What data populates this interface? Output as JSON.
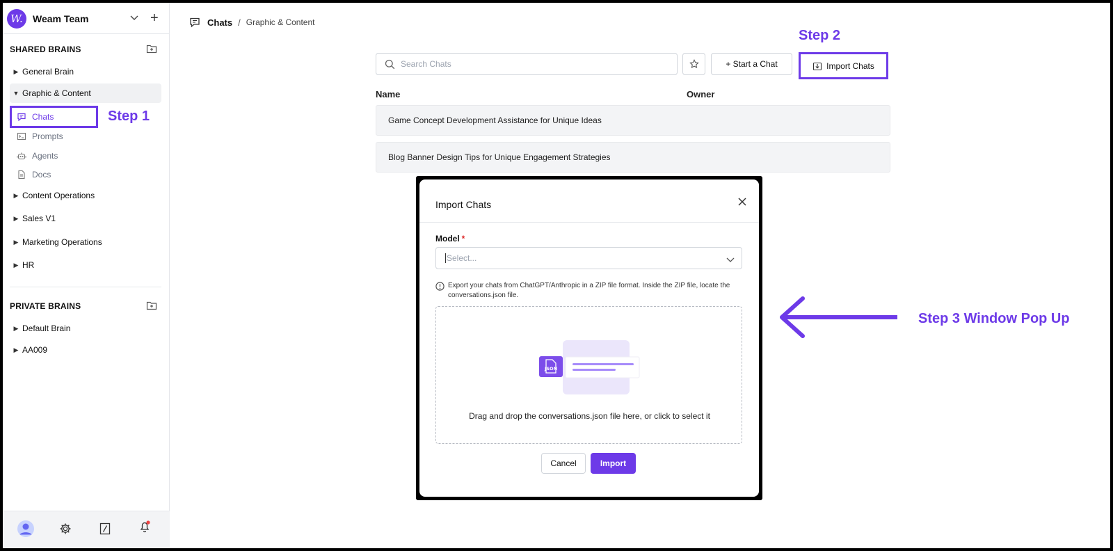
{
  "workspace": {
    "logo_letter": "W.",
    "name": "Weam Team"
  },
  "shared_brains": {
    "heading": "SHARED BRAINS",
    "items": [
      {
        "label": "General Brain"
      },
      {
        "label": "Graphic & Content",
        "expanded": true,
        "children": [
          {
            "label": "Chats"
          },
          {
            "label": "Prompts"
          },
          {
            "label": "Agents"
          },
          {
            "label": "Docs"
          }
        ]
      },
      {
        "label": "Content Operations"
      },
      {
        "label": "Sales V1"
      },
      {
        "label": "Marketing Operations"
      },
      {
        "label": "HR"
      }
    ]
  },
  "private_brains": {
    "heading": "PRIVATE BRAINS",
    "items": [
      {
        "label": "Default Brain"
      },
      {
        "label": "AA009"
      }
    ]
  },
  "breadcrumb": {
    "section": "Chats",
    "separator": "/",
    "current": "Graphic & Content"
  },
  "toolbar": {
    "search_placeholder": "Search Chats",
    "start_chat_label": "+ Start a Chat",
    "import_chats_label": "Import Chats"
  },
  "table": {
    "columns": [
      "Name",
      "Owner"
    ],
    "rows": [
      {
        "name": "Game Concept Development Assistance for Unique Ideas"
      },
      {
        "name": "Blog Banner Design Tips for Unique Engagement Strategies"
      }
    ]
  },
  "modal": {
    "title": "Import Chats",
    "model_label": "Model",
    "required_mark": "*",
    "select_placeholder": "Select...",
    "info_text": "Export your chats from ChatGPT/Anthropic in a ZIP file format. Inside the ZIP file, locate the conversations.json file.",
    "file_badge": "JSON",
    "dropzone_text": "Drag and drop the conversations.json file here, or click to select it",
    "cancel_label": "Cancel",
    "import_label": "Import"
  },
  "annotations": {
    "step1": "Step 1",
    "step2": "Step 2",
    "step3": "Step 3 Window  Pop Up"
  },
  "colors": {
    "accent": "#6d3ae8",
    "row_bg": "#f3f4f6",
    "required": "#dc2626",
    "notification_dot": "#ef4444"
  }
}
